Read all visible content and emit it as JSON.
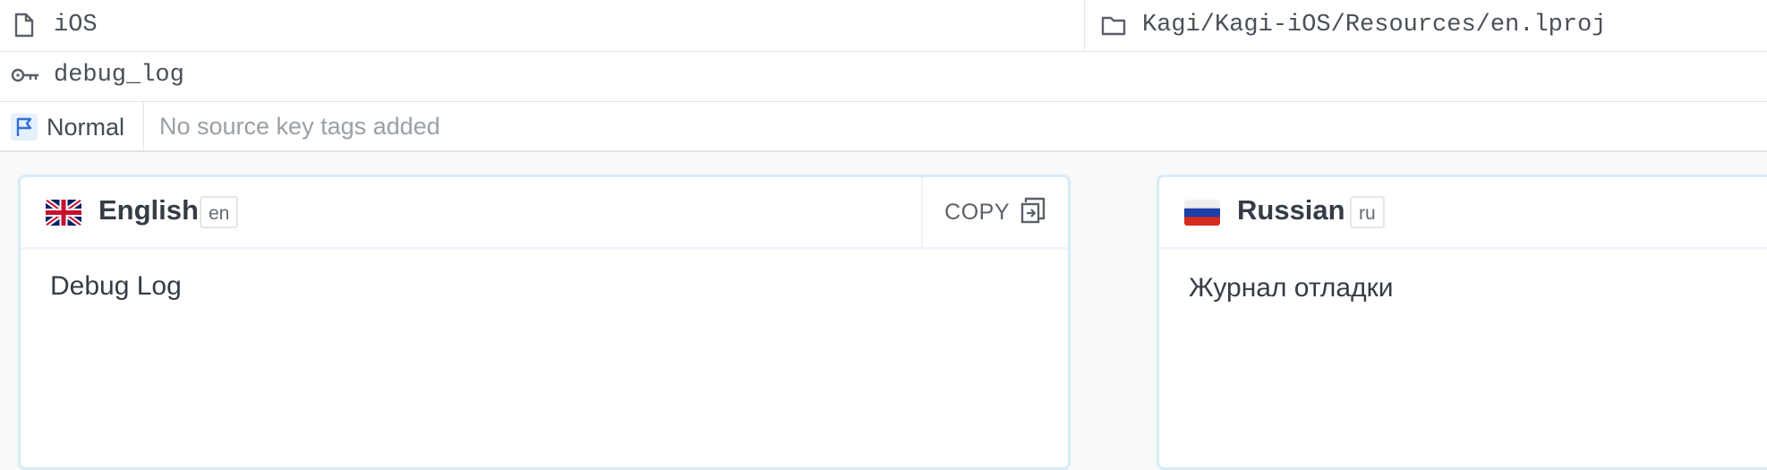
{
  "file_row": {
    "platform": "iOS",
    "path": "Kagi/Kagi-iOS/Resources/en.lproj"
  },
  "key_row": {
    "key_name": "debug_log"
  },
  "tags_row": {
    "priority": "Normal",
    "tags_placeholder": "No source key tags added"
  },
  "source": {
    "language": "English",
    "code": "en",
    "copy_label": "COPY",
    "text": "Debug Log"
  },
  "target": {
    "language": "Russian",
    "code": "ru",
    "text": "Журнал отладки"
  },
  "colors": {
    "card_border": "#d8ebf7",
    "priority_flag": "#2f6fd6",
    "background": "#f9f9f9"
  }
}
